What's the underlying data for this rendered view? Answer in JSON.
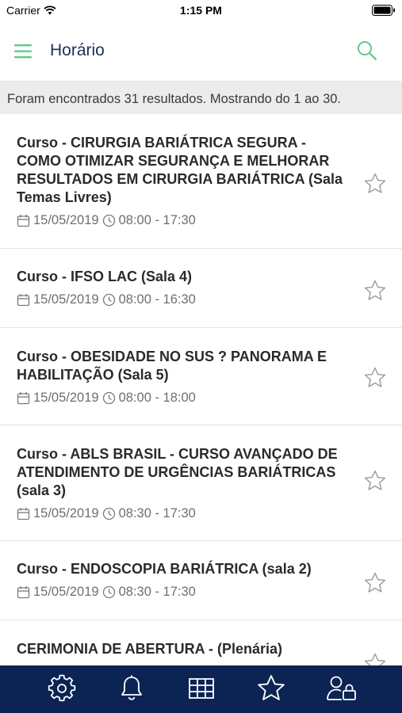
{
  "status_bar": {
    "carrier": "Carrier",
    "time": "1:15 PM",
    "wifi_icon": "wifi-icon",
    "battery_icon": "battery-icon"
  },
  "header": {
    "title": "Horário",
    "menu_icon": "hamburger-menu-icon",
    "search_icon": "search-icon",
    "accent_color": "#5fc98a",
    "title_color": "#1c2f5a"
  },
  "results": {
    "text": "Foram encontrados 31 resultados. Mostrando do 1 ao 30."
  },
  "sessions": [
    {
      "title": "Curso - CIRURGIA BARIÁTRICA SEGURA - COMO OTIMIZAR SEGURANÇA E MELHORAR RESULTADOS EM CIRURGIA BARIÁTRICA (Sala Temas Livres)",
      "date": "15/05/2019",
      "time": "08:00 - 17:30"
    },
    {
      "title": "Curso - IFSO LAC (Sala 4)",
      "date": "15/05/2019",
      "time": "08:00 - 16:30"
    },
    {
      "title": "Curso - OBESIDADE NO SUS ? PANORAMA E HABILITAÇÃO (Sala 5)",
      "date": "15/05/2019",
      "time": "08:00 - 18:00"
    },
    {
      "title": "Curso - ABLS BRASIL - CURSO AVANÇADO DE ATENDIMENTO DE URGÊNCIAS BARIÁTRICAS (sala 3)",
      "date": "15/05/2019",
      "time": "08:30 - 17:30"
    },
    {
      "title": "Curso - ENDOSCOPIA BARIÁTRICA (sala 2)",
      "date": "15/05/2019",
      "time": "08:30 - 17:30"
    },
    {
      "title": "CERIMONIA DE ABERTURA - (Plenária)",
      "date": "",
      "time": ""
    }
  ],
  "tabbar": {
    "background_color": "#0c2454",
    "tabs": [
      "gear-icon",
      "bell-icon",
      "grid-icon",
      "star-icon",
      "user-lock-icon"
    ]
  }
}
